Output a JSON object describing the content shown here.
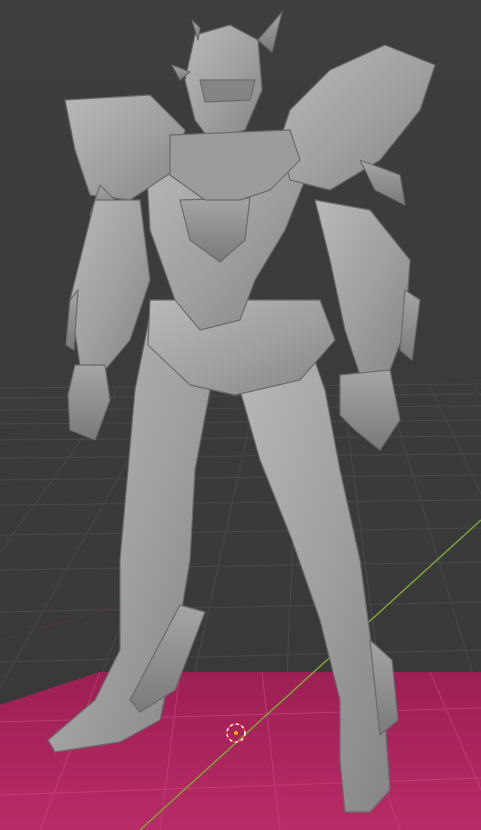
{
  "viewport": {
    "mode": "3d-viewport",
    "background_color": "#3d3d3d",
    "grid_color": "#4a4a4a",
    "axis_x_color": "#a83a4a",
    "axis_y_color": "#7ea23a",
    "selection_plane_color": "#b0205c",
    "model_color": "#9e9e9e",
    "cursor_colors": [
      "#ff3b3b",
      "#ffffff"
    ]
  },
  "scene": {
    "object": "mech-armor-figure",
    "icon": "3d-cursor-icon"
  }
}
